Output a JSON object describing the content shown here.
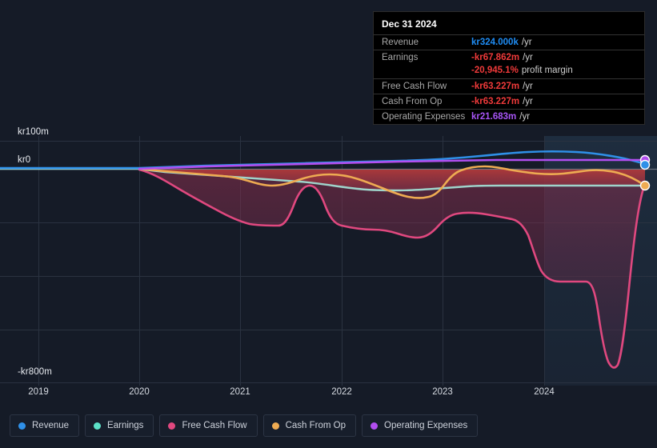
{
  "axes": {
    "y_top_label": "kr100m",
    "y_zero_label": "kr0",
    "y_bottom_label": "-kr800m",
    "x_ticks": [
      "2019",
      "2020",
      "2021",
      "2022",
      "2023",
      "2024"
    ]
  },
  "tooltip": {
    "date": "Dec 31 2024",
    "rows": [
      {
        "label": "Revenue",
        "value": "kr324.000k",
        "unit": "/yr",
        "color": "#1f8df5"
      },
      {
        "label": "Earnings",
        "value": "-kr67.862m",
        "unit": "/yr",
        "color": "#f03a3a"
      },
      {
        "label": "",
        "value": "-20,945.1%",
        "unit": "profit margin",
        "color": "#f03a3a"
      },
      {
        "label": "Free Cash Flow",
        "value": "-kr63.227m",
        "unit": "/yr",
        "color": "#f03a3a"
      },
      {
        "label": "Cash From Op",
        "value": "-kr63.227m",
        "unit": "/yr",
        "color": "#f03a3a"
      },
      {
        "label": "Operating Expenses",
        "value": "kr21.683m",
        "unit": "/yr",
        "color": "#a855f7"
      }
    ]
  },
  "legend": {
    "items": [
      {
        "label": "Revenue",
        "color": "#2f90e8"
      },
      {
        "label": "Earnings",
        "color": "#5ce1c8"
      },
      {
        "label": "Free Cash Flow",
        "color": "#e0487f"
      },
      {
        "label": "Cash From Op",
        "color": "#eeab52"
      },
      {
        "label": "Operating Expenses",
        "color": "#b24ef0"
      }
    ]
  },
  "chart_data": {
    "type": "area",
    "title": "",
    "xlabel": "",
    "ylabel": "",
    "ylim": [
      -800,
      100
    ],
    "y_unit": "kr (millions)",
    "grid": true,
    "legend_position": "bottom",
    "x": [
      2019.0,
      2019.5,
      2020.0,
      2020.25,
      2020.5,
      2020.75,
      2021.0,
      2021.25,
      2021.5,
      2021.75,
      2022.0,
      2022.25,
      2022.5,
      2022.75,
      2023.0,
      2023.25,
      2023.5,
      2023.75,
      2024.0,
      2024.25,
      2024.5,
      2024.75,
      2025.0
    ],
    "series": [
      {
        "name": "Revenue",
        "color": "#2f90e8",
        "values": [
          0,
          0,
          0,
          0,
          0,
          0,
          0,
          0,
          0,
          0,
          0,
          0,
          0,
          0,
          0,
          2,
          6,
          10,
          12,
          12,
          10,
          6,
          0.324
        ]
      },
      {
        "name": "Earnings",
        "color": "#5ce1c8",
        "values": [
          0,
          0,
          -5,
          -8,
          -10,
          -12,
          -14,
          -16,
          -18,
          -20,
          -22,
          -26,
          -30,
          -32,
          -34,
          -33,
          -32,
          -30,
          -30,
          -31,
          -32,
          -33,
          -67.862
        ]
      },
      {
        "name": "Free Cash Flow",
        "color": "#e0487f",
        "values": [
          0,
          0,
          -40,
          -80,
          -120,
          -160,
          -200,
          -215,
          -220,
          -150,
          -230,
          -235,
          -240,
          -260,
          -230,
          -200,
          -195,
          -190,
          -300,
          -305,
          -760,
          -300,
          -63.227
        ]
      },
      {
        "name": "Cash From Op",
        "color": "#eeab52",
        "values": [
          0,
          0,
          -8,
          -12,
          -16,
          -22,
          -26,
          -24,
          -22,
          -20,
          -24,
          -36,
          -44,
          -48,
          -52,
          -40,
          -28,
          -24,
          -22,
          -20,
          -24,
          -34,
          -63.227
        ]
      },
      {
        "name": "Operating Expenses",
        "color": "#b24ef0",
        "values": [
          0,
          0,
          4,
          6,
          8,
          9,
          10,
          11,
          12,
          13,
          14,
          15,
          16,
          17,
          18,
          19,
          20,
          20,
          21,
          21,
          21,
          21,
          21.683
        ]
      }
    ],
    "highlight_band": {
      "from": 2024.0,
      "to": 2025.0
    },
    "endpoint_markers": [
      {
        "series": "Operating Expenses",
        "color": "#b24ef0"
      },
      {
        "series": "Revenue",
        "color": "#2f90e8"
      },
      {
        "series": "Cash From Op",
        "color": "#eeab52"
      }
    ]
  }
}
